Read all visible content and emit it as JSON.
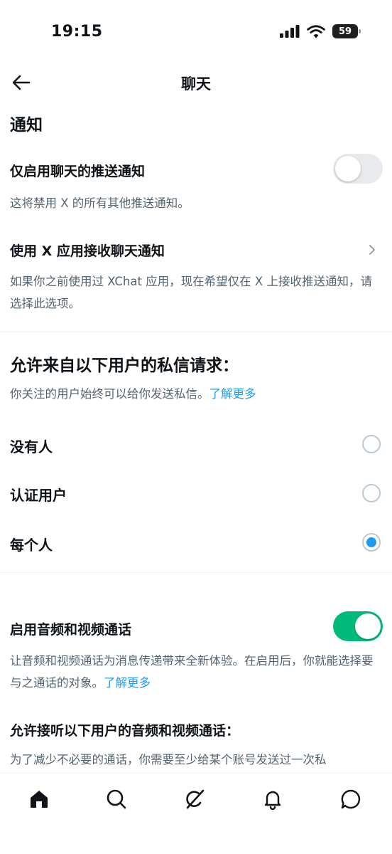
{
  "status_bar": {
    "time": "19:15",
    "battery": "59",
    "icons": [
      "signal-icon",
      "wifi-icon",
      "battery-icon"
    ]
  },
  "header": {
    "title": "聊天",
    "back_icon": "back-arrow-icon"
  },
  "notifications": {
    "heading": "通知",
    "chat_push_only": {
      "label": "仅启用聊天的推送通知",
      "enabled": false,
      "description": "这将禁用 X 的所有其他推送通知。"
    },
    "use_x_app": {
      "label": "使用 X 应用接收聊天通知",
      "description": "如果你之前使用过 XChat 应用，现在希望仅在 X 上接收推送通知，请选择此选项。"
    }
  },
  "dm_requests": {
    "heading": "允许来自以下用户的私信请求：",
    "description": "你关注的用户始终可以给你发送私信。",
    "learn_more": "了解更多",
    "options": [
      {
        "label": "没有人",
        "selected": false
      },
      {
        "label": "认证用户",
        "selected": false
      },
      {
        "label": "每个人",
        "selected": true
      }
    ]
  },
  "calls": {
    "label": "启用音频和视频通话",
    "enabled": true,
    "description": "让音频和视频通话为消息传递带来全新体验。在启用后，你就能选择要与之通话的对象。",
    "learn_more": "了解更多",
    "allow_heading": "允许接听以下用户的音频和视频通话：",
    "allow_description": "为了减少不必要的通话，你需要至少给某个账号发送过一次私"
  },
  "tab_bar": {
    "tabs": [
      "home-icon",
      "search-icon",
      "grok-icon",
      "notifications-icon",
      "messages-icon"
    ],
    "active": "home-icon"
  },
  "colors": {
    "accent": "#1d9bf0",
    "toggle_on": "#00ba7c",
    "toggle_off": "#e8eaed",
    "secondary_text": "#536471"
  }
}
